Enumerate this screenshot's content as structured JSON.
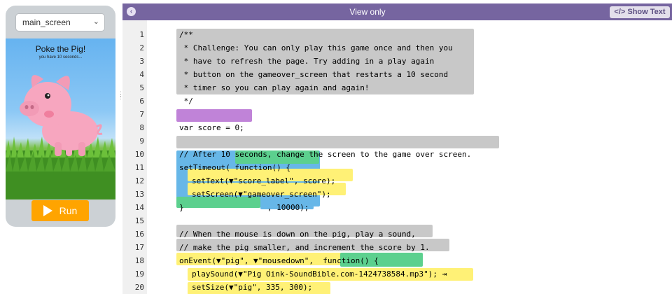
{
  "phone": {
    "screen_select": "main_screen",
    "app_title": "Poke the Pig!",
    "app_score": "you have 10 seconds...",
    "run_label": "Run"
  },
  "editor": {
    "header_label": "View only",
    "show_text_label": "Show Text",
    "lines": [
      {
        "n": "1",
        "text": "/**"
      },
      {
        "n": "2",
        "text": " * Challenge: You can only play this game once and then you"
      },
      {
        "n": "3",
        "text": " * have to refresh the page. Try adding in a play again"
      },
      {
        "n": "4",
        "text": " * button on the gameover_screen that restarts a 10 second"
      },
      {
        "n": "5",
        "text": " * timer so you can play again and again!"
      },
      {
        "n": "6",
        "text": " */"
      },
      {
        "n": "7",
        "text": ""
      },
      {
        "n": "8",
        "text": "var score = 0;"
      },
      {
        "n": "9",
        "text": ""
      },
      {
        "n": "10",
        "text": "// After 10 seconds, change the screen to the game over screen."
      },
      {
        "n": "11",
        "text": "setTimeout( function() {"
      },
      {
        "n": "12",
        "text": "setText(▼\"score_label\", score);"
      },
      {
        "n": "13",
        "text": "setScreen(▼\"gameover_screen\");"
      },
      {
        "n": "14",
        "text": "}                  , 10000);"
      },
      {
        "n": "15",
        "text": ""
      },
      {
        "n": "16",
        "text": "// When the mouse is down on the pig, play a sound,"
      },
      {
        "n": "17",
        "text": "// make the pig smaller, and increment the score by 1."
      },
      {
        "n": "18",
        "text": "onEvent(▼\"pig\", ▼\"mousedown\",  function() {"
      },
      {
        "n": "19",
        "text": "playSound(▼\"Pig Oink-SoundBible.com-1424738584.mp3\"); ⇥"
      },
      {
        "n": "20",
        "text": "setSize(▼\"pig\", 335, 300);"
      }
    ]
  }
}
